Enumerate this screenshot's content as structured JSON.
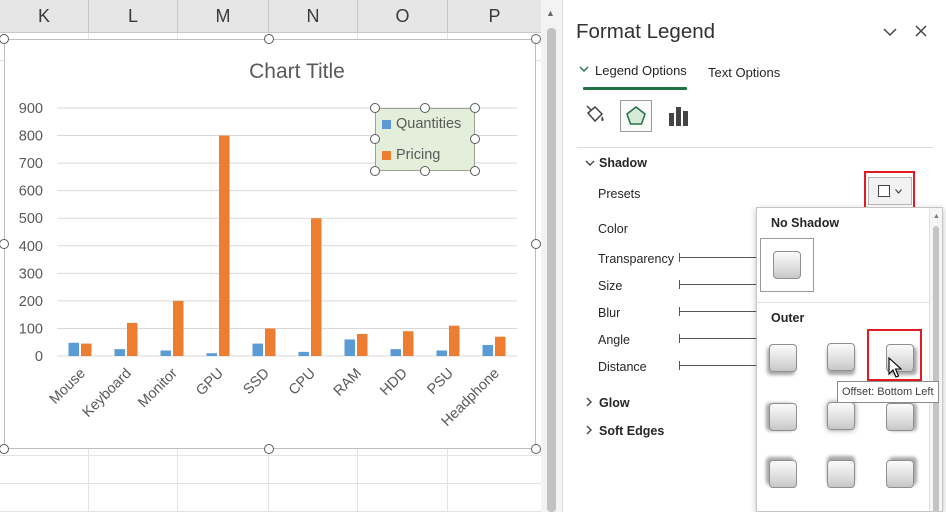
{
  "sheet": {
    "columns": [
      "K",
      "L",
      "M",
      "N",
      "O",
      "P"
    ]
  },
  "chart_data": {
    "type": "bar",
    "title": "Chart Title",
    "categories": [
      "Mouse",
      "Keyboard",
      "Monitor",
      "GPU",
      "SSD",
      "CPU",
      "RAM",
      "HDD",
      "PSU",
      "Headphone"
    ],
    "series": [
      {
        "name": "Quantities",
        "color": "#5b9bd5",
        "values": [
          48,
          25,
          20,
          10,
          45,
          15,
          60,
          25,
          20,
          40
        ]
      },
      {
        "name": "Pricing",
        "color": "#ed7d31",
        "values": [
          45,
          120,
          200,
          800,
          100,
          500,
          80,
          90,
          110,
          70
        ]
      }
    ],
    "y_ticks": [
      0,
      100,
      200,
      300,
      400,
      500,
      600,
      700,
      800,
      900
    ],
    "ylim": [
      0,
      900
    ],
    "grid": true,
    "legend_position": "top-right",
    "legend_fill": "#e3efdb"
  },
  "pane": {
    "title": "Format Legend",
    "tabs": [
      "Legend Options",
      "Text Options"
    ],
    "active_tab": "Legend Options",
    "icons": [
      "fill-bucket-icon",
      "effects-pentagon-icon",
      "bar-chart-icon"
    ],
    "sections": {
      "shadow": "Shadow",
      "glow": "Glow",
      "soft_edges": "Soft Edges"
    },
    "shadow_props": {
      "presets": "Presets",
      "color": "Color",
      "transparency": "Transparency",
      "size": "Size",
      "blur": "Blur",
      "angle": "Angle",
      "distance": "Distance"
    }
  },
  "dropdown": {
    "no_shadow": "No Shadow",
    "outer": "Outer",
    "tooltip": "Offset: Bottom Left"
  },
  "colors": {
    "accent": "#217346",
    "highlight": "#e11b22"
  }
}
